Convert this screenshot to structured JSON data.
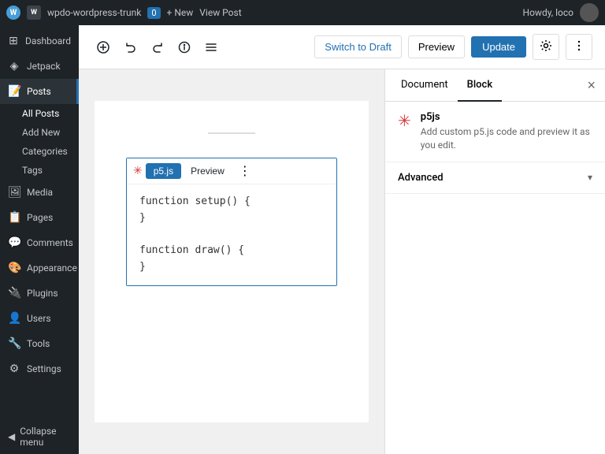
{
  "adminBar": {
    "siteName": "wpdo-wordpress-trunk",
    "commentCount": "0",
    "newLabel": "+ New",
    "viewPostLabel": "View Post",
    "howdy": "Howdy, loco"
  },
  "sidebar": {
    "items": [
      {
        "id": "dashboard",
        "label": "Dashboard",
        "icon": "⊞"
      },
      {
        "id": "jetpack",
        "label": "Jetpack",
        "icon": "◈"
      },
      {
        "id": "posts",
        "label": "Posts",
        "icon": "📄",
        "active": true
      },
      {
        "id": "media",
        "label": "Media",
        "icon": "🖼"
      },
      {
        "id": "pages",
        "label": "Pages",
        "icon": "📋"
      },
      {
        "id": "comments",
        "label": "Comments",
        "icon": "💬"
      },
      {
        "id": "appearance",
        "label": "Appearance",
        "icon": "🎨"
      },
      {
        "id": "plugins",
        "label": "Plugins",
        "icon": "🔌"
      },
      {
        "id": "users",
        "label": "Users",
        "icon": "👤"
      },
      {
        "id": "tools",
        "label": "Tools",
        "icon": "🔧"
      },
      {
        "id": "settings",
        "label": "Settings",
        "icon": "⚙"
      }
    ],
    "subItems": [
      {
        "id": "all-posts",
        "label": "All Posts",
        "active": true
      },
      {
        "id": "add-new",
        "label": "Add New"
      },
      {
        "id": "categories",
        "label": "Categories"
      },
      {
        "id": "tags",
        "label": "Tags"
      }
    ],
    "collapseLabel": "Collapse menu"
  },
  "toolbar": {
    "switchToDraftLabel": "Switch to Draft",
    "previewLabel": "Preview",
    "updateLabel": "Update"
  },
  "block": {
    "name": "p5js",
    "previewTabLabel": "Preview",
    "p5jsTabLabel": "p5.js",
    "description": "Add custom p5.js code and preview it as you edit.",
    "code": "function setup() {\n}\n\nfunction draw() {\n}"
  },
  "inspector": {
    "documentTabLabel": "Document",
    "blockTabLabel": "Block",
    "advancedSectionLabel": "Advanced"
  }
}
